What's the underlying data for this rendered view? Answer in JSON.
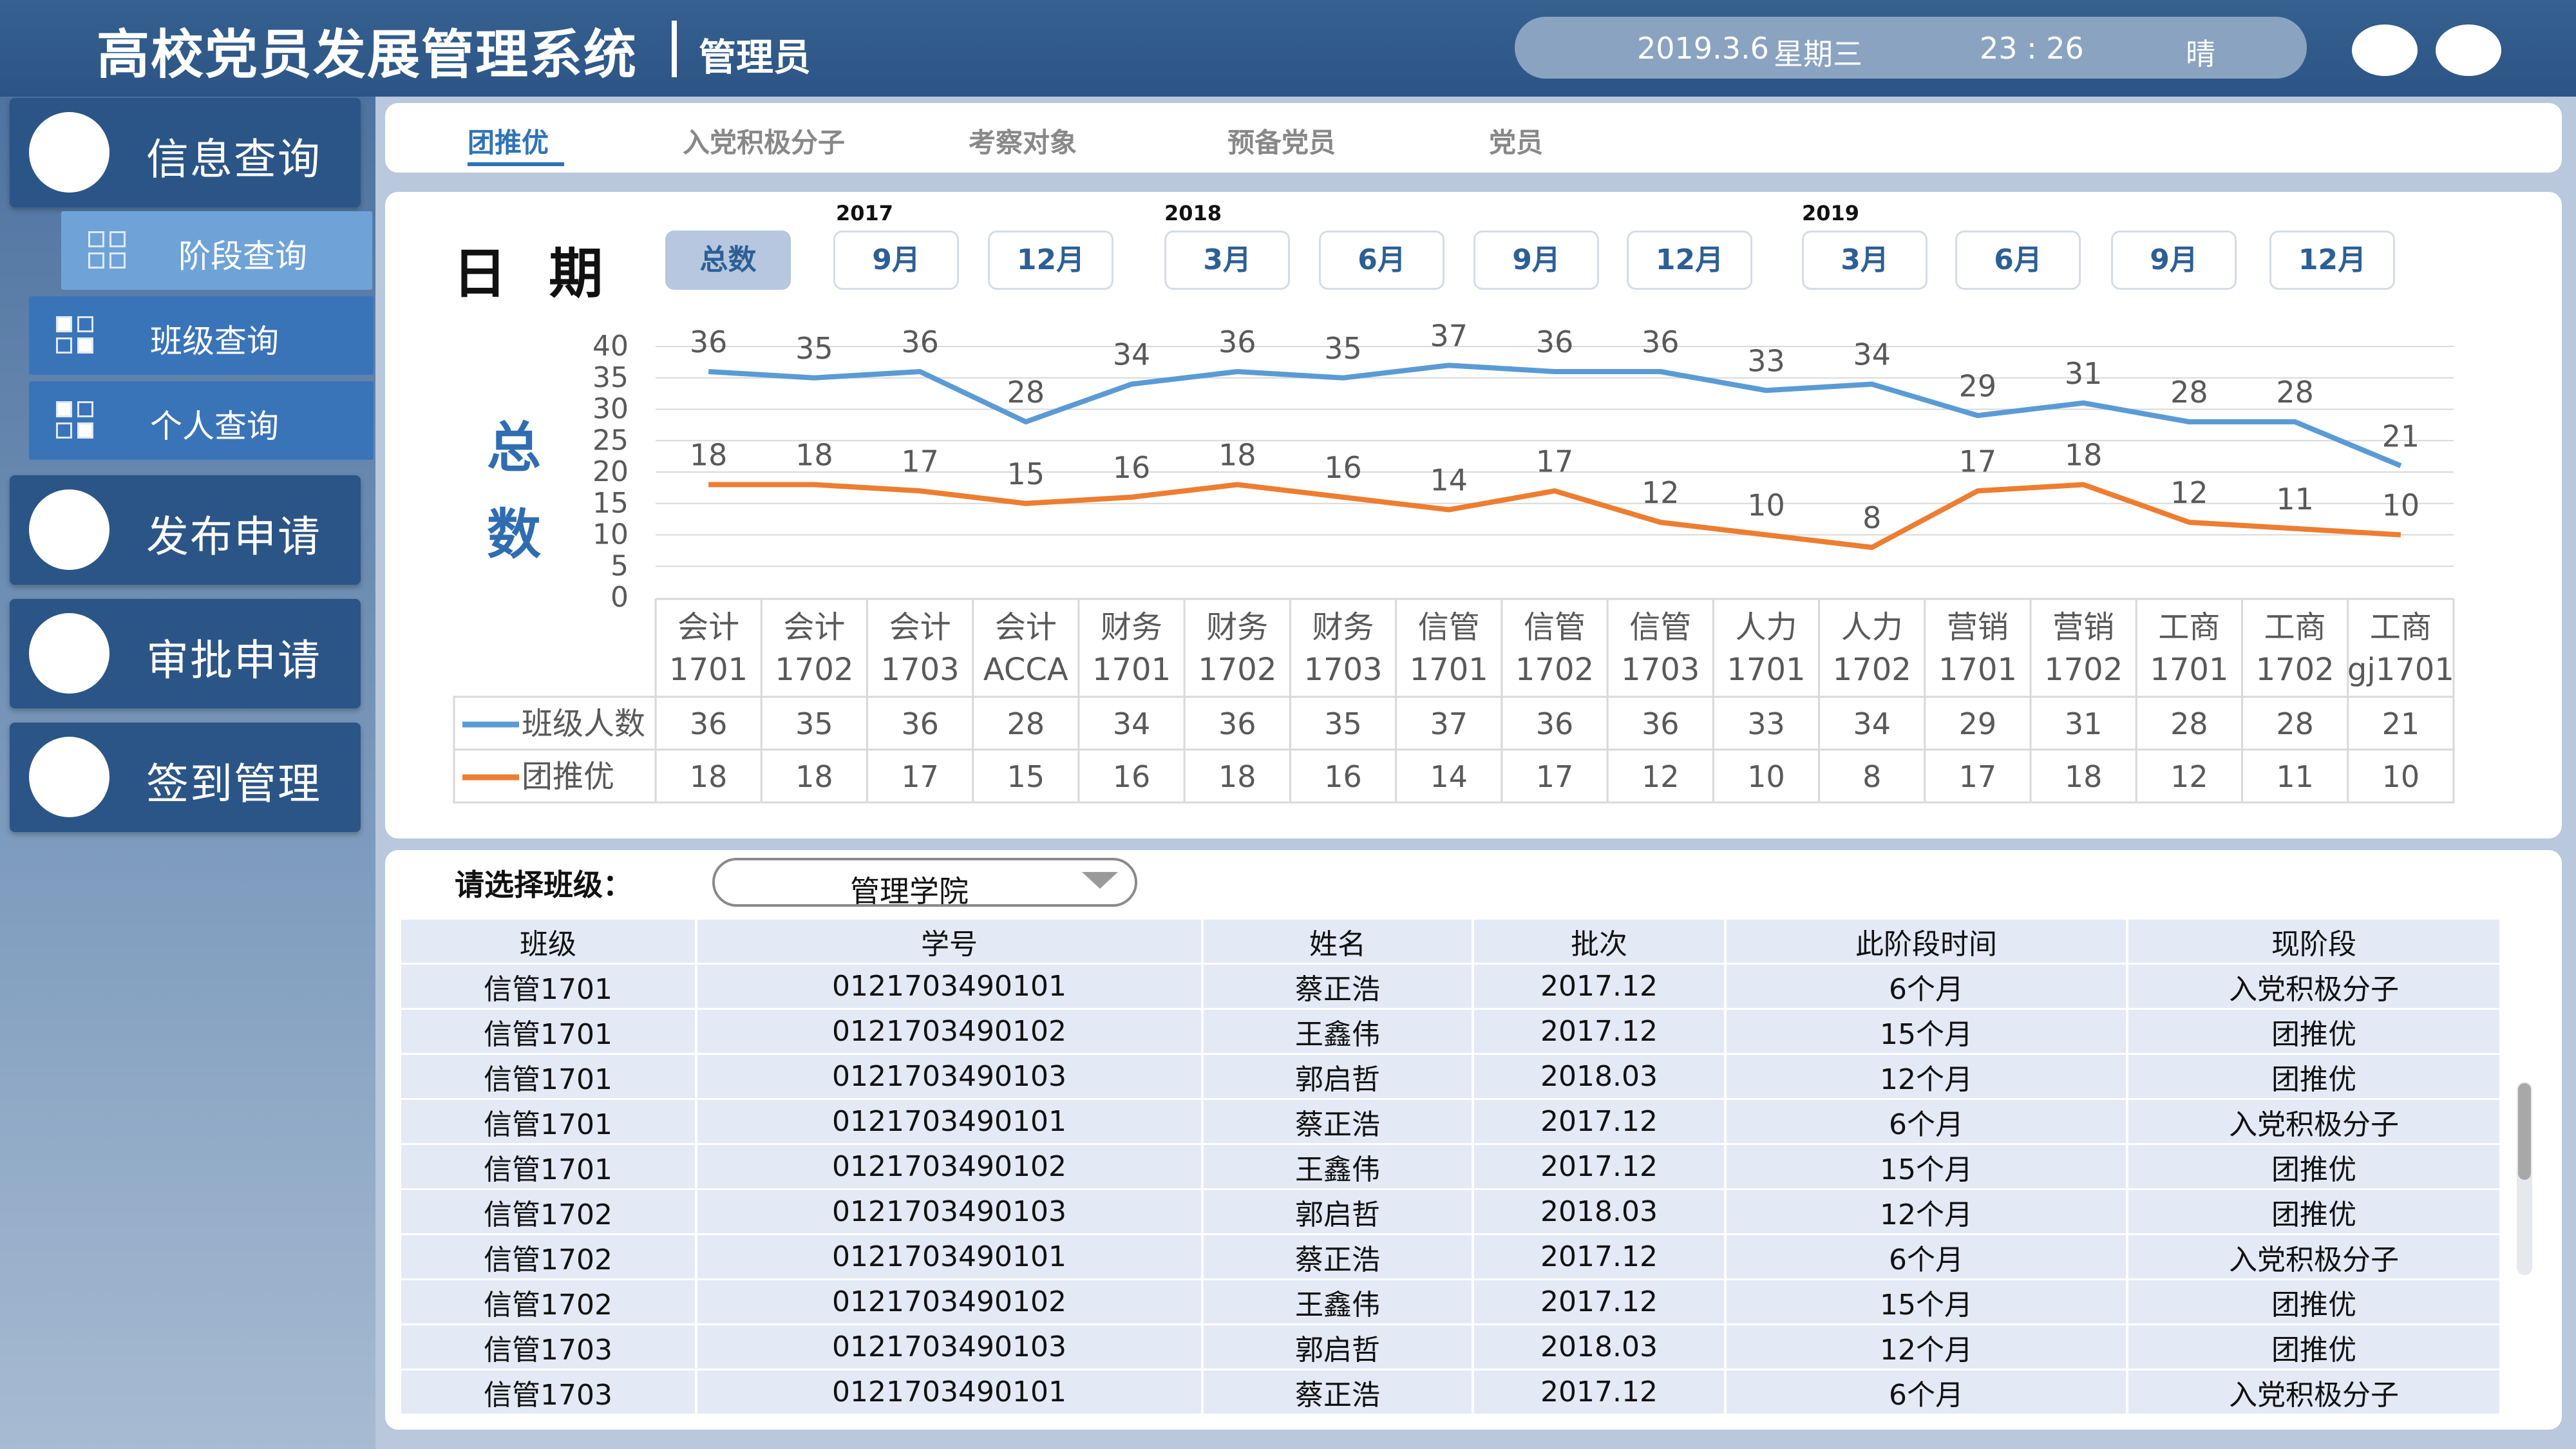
{
  "header": {
    "title": "高校党员发展管理系统",
    "role": "管理员",
    "date": "2019.3.6",
    "weekday": "星期三",
    "time": "23 : 26",
    "weather": "晴"
  },
  "sidebar": {
    "main_items": [
      {
        "label": "信息查询"
      },
      {
        "label": "发布申请"
      },
      {
        "label": "审批申请"
      },
      {
        "label": "签到管理"
      }
    ],
    "sub_items": [
      {
        "label": "阶段查询"
      },
      {
        "label": "班级查询"
      },
      {
        "label": "个人查询"
      }
    ]
  },
  "tabs": [
    "团推优",
    "入党积极分子",
    "考察对象",
    "预备党员",
    "党员"
  ],
  "chart_header": {
    "title": "日 期",
    "buttons": [
      "总数",
      "9月",
      "12月",
      "3月",
      "6月",
      "9月",
      "12月",
      "3月",
      "6月",
      "9月",
      "12月"
    ],
    "years": [
      "2017",
      "2018",
      "2019"
    ],
    "metric_label": "总数"
  },
  "chart_data": {
    "type": "line",
    "categories_line1": [
      "会计",
      "会计",
      "会计",
      "会计",
      "财务",
      "财务",
      "财务",
      "信管",
      "信管",
      "信管",
      "人力",
      "人力",
      "营销",
      "营销",
      "工商",
      "工商",
      "工商"
    ],
    "categories_line2": [
      "1701",
      "1702",
      "1703",
      "ACCA",
      "1701",
      "1702",
      "1703",
      "1701",
      "1702",
      "1703",
      "1701",
      "1702",
      "1701",
      "1702",
      "1701",
      "1702",
      "gj1701"
    ],
    "series": [
      {
        "name": "班级人数",
        "color": "#5b9bd5",
        "values": [
          36,
          35,
          36,
          28,
          34,
          36,
          35,
          37,
          36,
          36,
          33,
          34,
          29,
          31,
          28,
          28,
          21
        ]
      },
      {
        "name": "团推优",
        "color": "#ed7d31",
        "values": [
          18,
          18,
          17,
          15,
          16,
          18,
          16,
          14,
          17,
          12,
          10,
          8,
          17,
          18,
          12,
          11,
          10
        ]
      }
    ],
    "y_ticks": [
      "0",
      "5",
      "10",
      "15",
      "20",
      "25",
      "30",
      "35",
      "40"
    ],
    "ylim": [
      0,
      40
    ],
    "grid": true,
    "legend": "data-table"
  },
  "class_filter": {
    "label": "请选择班级：",
    "value": "管理学院"
  },
  "table": {
    "headers": [
      "班级",
      "学号",
      "姓名",
      "批次",
      "此阶段时间",
      "现阶段"
    ],
    "rows": [
      [
        "信管1701",
        "0121703490101",
        "蔡正浩",
        "2017.12",
        "6个月",
        "入党积极分子"
      ],
      [
        "信管1701",
        "0121703490102",
        "王鑫伟",
        "2017.12",
        "15个月",
        "团推优"
      ],
      [
        "信管1701",
        "0121703490103",
        "郭启哲",
        "2018.03",
        "12个月",
        "团推优"
      ],
      [
        "信管1701",
        "0121703490101",
        "蔡正浩",
        "2017.12",
        "6个月",
        "入党积极分子"
      ],
      [
        "信管1701",
        "0121703490102",
        "王鑫伟",
        "2017.12",
        "15个月",
        "团推优"
      ],
      [
        "信管1702",
        "0121703490103",
        "郭启哲",
        "2018.03",
        "12个月",
        "团推优"
      ],
      [
        "信管1702",
        "0121703490101",
        "蔡正浩",
        "2017.12",
        "6个月",
        "入党积极分子"
      ],
      [
        "信管1702",
        "0121703490102",
        "王鑫伟",
        "2017.12",
        "15个月",
        "团推优"
      ],
      [
        "信管1703",
        "0121703490103",
        "郭启哲",
        "2018.03",
        "12个月",
        "团推优"
      ],
      [
        "信管1703",
        "0121703490101",
        "蔡正浩",
        "2017.12",
        "6个月",
        "入党积极分子"
      ]
    ]
  }
}
